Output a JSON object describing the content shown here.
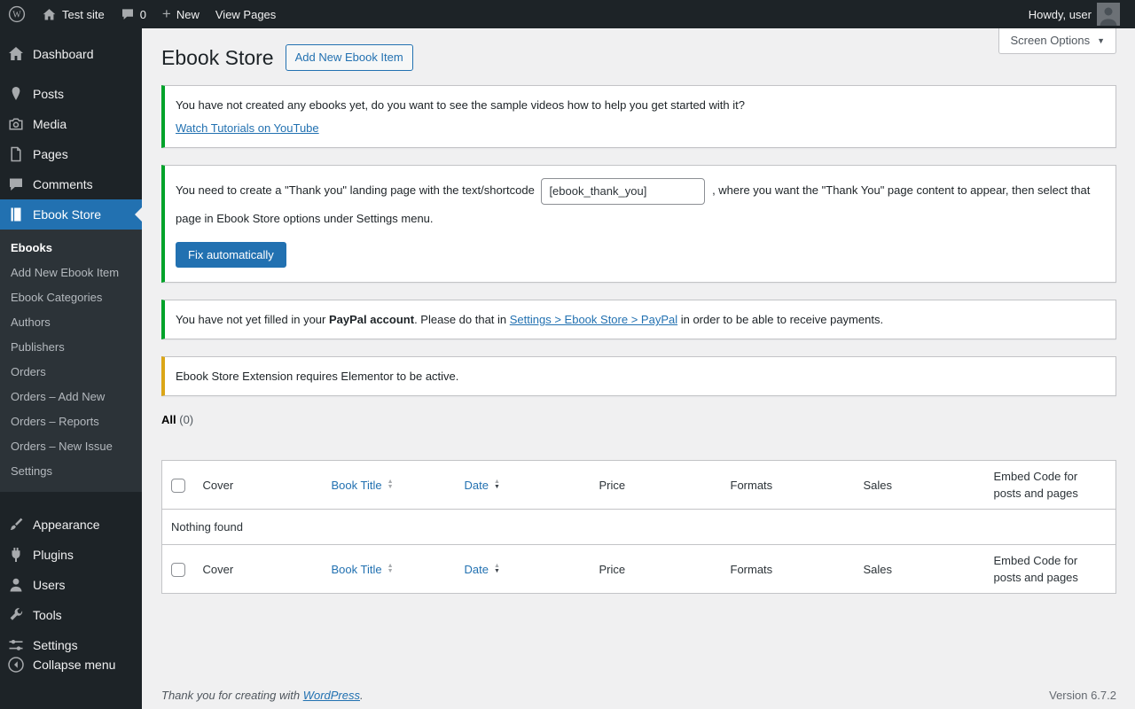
{
  "admin_bar": {
    "site_name": "Test site",
    "comment_count": "0",
    "new_label": "New",
    "view_pages_label": "View Pages",
    "howdy_text": "Howdy, user"
  },
  "sidebar": {
    "items": [
      {
        "label": "Dashboard"
      },
      {
        "label": "Posts"
      },
      {
        "label": "Media"
      },
      {
        "label": "Pages"
      },
      {
        "label": "Comments"
      },
      {
        "label": "Ebook Store"
      },
      {
        "label": "Appearance"
      },
      {
        "label": "Plugins"
      },
      {
        "label": "Users"
      },
      {
        "label": "Tools"
      },
      {
        "label": "Settings"
      }
    ],
    "submenu": [
      {
        "label": "Ebooks"
      },
      {
        "label": "Add New Ebook Item"
      },
      {
        "label": "Ebook Categories"
      },
      {
        "label": "Authors"
      },
      {
        "label": "Publishers"
      },
      {
        "label": "Orders"
      },
      {
        "label": "Orders – Add New"
      },
      {
        "label": "Orders – Reports"
      },
      {
        "label": "Orders – New Issue"
      },
      {
        "label": "Settings"
      }
    ],
    "collapse_label": "Collapse menu"
  },
  "page": {
    "title": "Ebook Store",
    "add_new_button": "Add New Ebook Item",
    "screen_options_label": "Screen Options"
  },
  "notices": {
    "tutorial": {
      "text": "You have not created any ebooks yet, do you want to see the sample videos how to help you get started with it?",
      "link": "Watch Tutorials on YouTube"
    },
    "thank_you": {
      "text_before": "You need to create a \"Thank you\" landing page with the text/shortcode",
      "shortcode_value": "[ebook_thank_you]",
      "text_after": ", where you want the \"Thank You\" page content to appear, then select that page in Ebook Store options under Settings menu.",
      "button_label": "Fix automatically"
    },
    "paypal": {
      "text_start": "You have not yet filled in your ",
      "bold": "PayPal account",
      "text_mid": ". Please do that in ",
      "link": "Settings > Ebook Store > PayPal",
      "text_end": " in order to be able to receive payments."
    },
    "elementor": {
      "text": "Ebook Store Extension requires Elementor to be active."
    }
  },
  "filters": {
    "all_label": "All",
    "all_count": "(0)"
  },
  "table": {
    "columns": {
      "cover": "Cover",
      "book_title": "Book Title",
      "date": "Date",
      "price": "Price",
      "formats": "Formats",
      "sales": "Sales",
      "embed": "Embed Code for posts and pages"
    },
    "empty_text": "Nothing found"
  },
  "footer": {
    "thanks_text": "Thank you for creating with ",
    "wordpress_link": "WordPress",
    "period": ".",
    "version": "Version 6.7.2"
  },
  "colors": {
    "accent": "#2271b1",
    "admin_bar_bg": "#1d2327",
    "notice_success": "#00a32a",
    "notice_warning": "#dba617"
  }
}
